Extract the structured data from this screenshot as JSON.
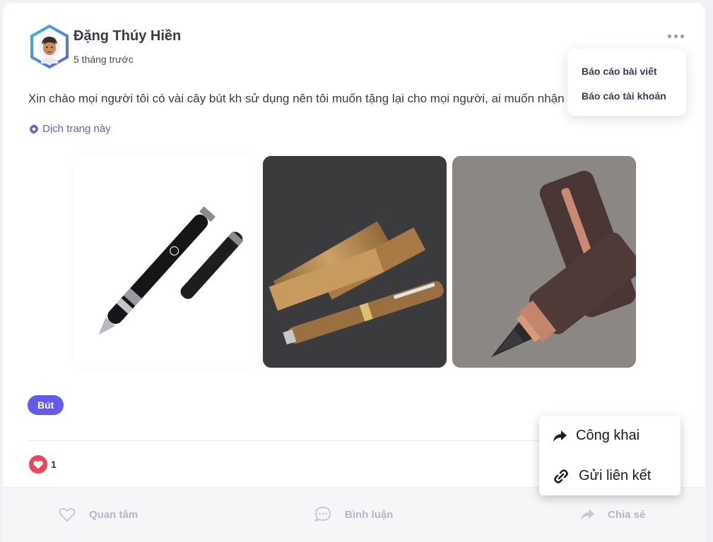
{
  "post": {
    "author_name": "Đặng Thúy Hiền",
    "time_ago": "5 tháng trước",
    "text": "Xin chào mọi người tôi có vài cây bút kh sử dụng nên tôi muốn tặng lại cho mọi người, ai muốn nhận",
    "translate_label": "Dịch trang này",
    "tag": "Bút",
    "reaction_count": "1",
    "icons": {
      "avatar": "avatar-hexagon-icon",
      "more": "ellipsis-icon",
      "translate": "gear-icon",
      "reaction": "heart-icon"
    }
  },
  "report_menu": {
    "items": [
      {
        "label": "Báo cáo bài viết"
      },
      {
        "label": "Báo cáo tài khoản"
      }
    ]
  },
  "share_menu": {
    "items": [
      {
        "label": "Công khai",
        "icon": "share-arrow-icon"
      },
      {
        "label": "Gửi liên kết",
        "icon": "link-icon"
      }
    ]
  },
  "actions": [
    {
      "label": "Quan tâm",
      "icon": "heart-outline-icon"
    },
    {
      "label": "Bình luận",
      "icon": "comment-icon"
    },
    {
      "label": "Chia sẻ",
      "icon": "share-icon"
    }
  ],
  "colors": {
    "accent": "#6259f0",
    "link": "#5a63d6",
    "heart": "#f0425a",
    "muted": "#b4b6c4"
  }
}
